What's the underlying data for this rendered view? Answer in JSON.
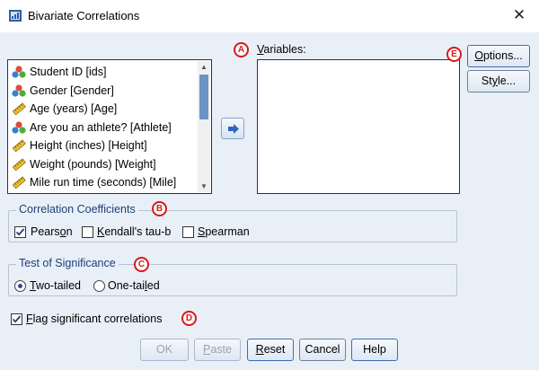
{
  "window": {
    "title": "Bivariate Correlations",
    "close_glyph": "✕"
  },
  "source_vars": [
    {
      "label": "Student ID [ids]",
      "icon": "nominal-icon"
    },
    {
      "label": "Gender [Gender]",
      "icon": "nominal-icon"
    },
    {
      "label": "Age (years) [Age]",
      "icon": "scale-ruler-icon"
    },
    {
      "label": "Are you an athlete? [Athlete]",
      "icon": "nominal-icon"
    },
    {
      "label": "Height (inches) [Height]",
      "icon": "scale-ruler-icon"
    },
    {
      "label": "Weight (pounds) [Weight]",
      "icon": "scale-ruler-icon"
    },
    {
      "label": "Mile run time (seconds) [Mile]",
      "icon": "scale-ruler-icon"
    }
  ],
  "variables": {
    "u": "V",
    "rest": "ariables:"
  },
  "buttons": {
    "options": {
      "u": "O",
      "rest": "ptions..."
    },
    "style": {
      "pre": "St",
      "u": "y",
      "rest": "le..."
    },
    "ok": "OK",
    "paste": {
      "u": "P",
      "rest": "aste"
    },
    "reset": {
      "u": "R",
      "rest": "eset"
    },
    "cancel": "Cancel",
    "help": "Help"
  },
  "correlation_group": {
    "title": "Correlation Coefficients",
    "pearson": {
      "pre": "Pears",
      "u": "o",
      "rest": "n",
      "checked": true
    },
    "kendall": {
      "u": "K",
      "rest": "endall's tau-b",
      "checked": false
    },
    "spearman": {
      "u": "S",
      "rest": "pearman",
      "checked": false
    }
  },
  "significance_group": {
    "title": "Test of Significance",
    "two_tailed": {
      "u": "T",
      "rest": "wo-tailed",
      "selected": true
    },
    "one_tailed": {
      "pre": "One-tai",
      "u": "l",
      "rest": "ed",
      "selected": false
    }
  },
  "flag": {
    "u": "F",
    "rest": "lag significant correlations",
    "checked": true
  },
  "badges": {
    "a": "A",
    "b": "B",
    "c": "C",
    "d": "D",
    "e": "E"
  },
  "colors": {
    "badge": "#d71a1a",
    "group_title": "#1c3f7a",
    "client_bg": "#e9eff7",
    "thumb": "#6a93c8"
  }
}
